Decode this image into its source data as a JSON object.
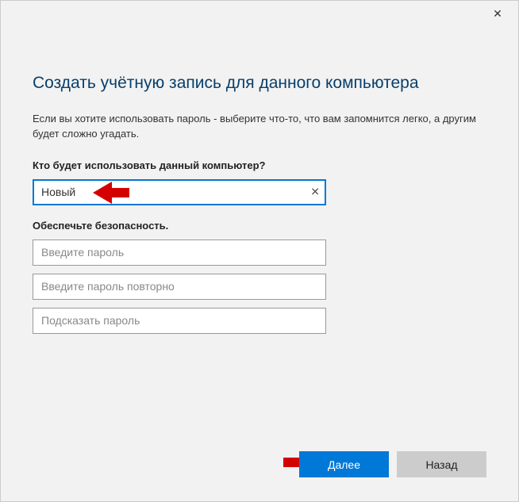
{
  "window": {
    "title": "Создать учётную запись для данного компьютера",
    "description": "Если вы хотите использовать пароль - выберите что-то, что вам запомнится легко, а другим будет сложно угадать."
  },
  "section_user": {
    "label": "Кто будет использовать данный компьютер?",
    "username_value": "Новый"
  },
  "section_security": {
    "label": "Обеспечьте безопасность.",
    "password_placeholder": "Введите пароль",
    "password_confirm_placeholder": "Введите пароль повторно",
    "hint_placeholder": "Подсказать пароль"
  },
  "buttons": {
    "next": "Далее",
    "back": "Назад"
  },
  "colors": {
    "accent": "#0078d7",
    "arrow": "#d40000"
  }
}
